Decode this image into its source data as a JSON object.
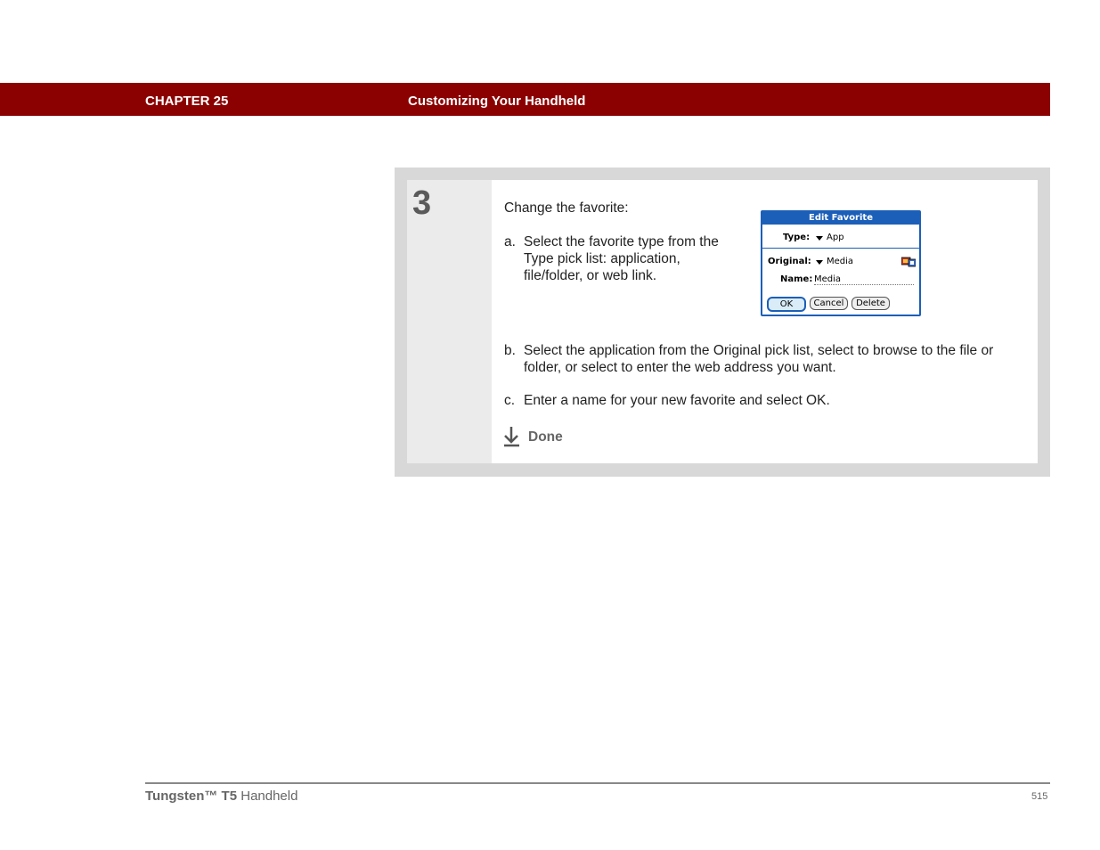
{
  "header": {
    "chapter": "CHAPTER 25",
    "title": "Customizing Your Handheld"
  },
  "step": {
    "number": "3",
    "intro": "Change the favorite:",
    "items": [
      {
        "letter": "a.",
        "text": "Select the favorite type from the Type pick list: application, file/folder, or web link."
      },
      {
        "letter": "b.",
        "text": "Select the application from the Original pick list, select to browse to the file or folder, or select to enter the web address you want."
      },
      {
        "letter": "c.",
        "text": "Enter a name for your new favorite and select OK."
      }
    ],
    "done_label": "Done",
    "done_icon": "done-arrow-icon"
  },
  "dialog": {
    "title": "Edit Favorite",
    "type_label": "Type:",
    "type_value": "App",
    "original_label": "Original:",
    "original_value": "Media",
    "name_label": "Name:",
    "name_value": "Media",
    "buttons": [
      "OK",
      "Cancel",
      "Delete"
    ],
    "accent_color": "#1c5fb8"
  },
  "footer": {
    "product_brand": "Tungsten™ T5",
    "product_suffix": "Handheld",
    "page_number": "515"
  },
  "colors": {
    "header_bar": "#8b0000",
    "step_frame": "#d8d8d8"
  }
}
